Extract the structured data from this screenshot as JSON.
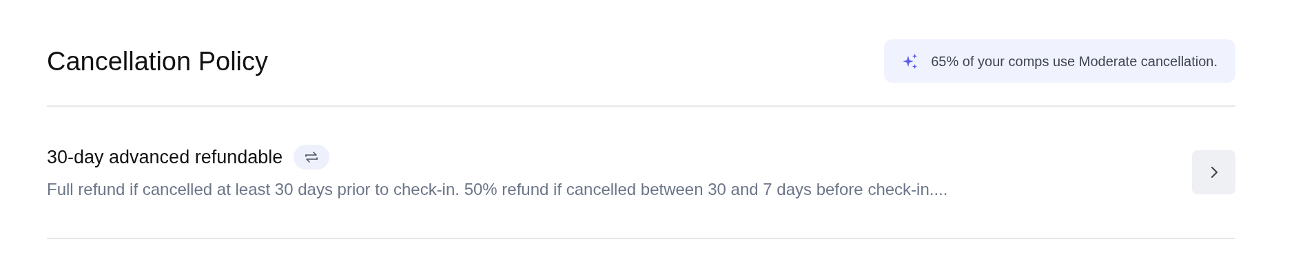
{
  "header": {
    "title": "Cancellation Policy",
    "insight": "65% of your comps use Moderate cancellation."
  },
  "policies": [
    {
      "title": "30-day advanced refundable",
      "description": "Full refund if cancelled at least 30 days prior to check-in. 50% refund if cancelled between 30 and 7 days before check-in...."
    }
  ]
}
